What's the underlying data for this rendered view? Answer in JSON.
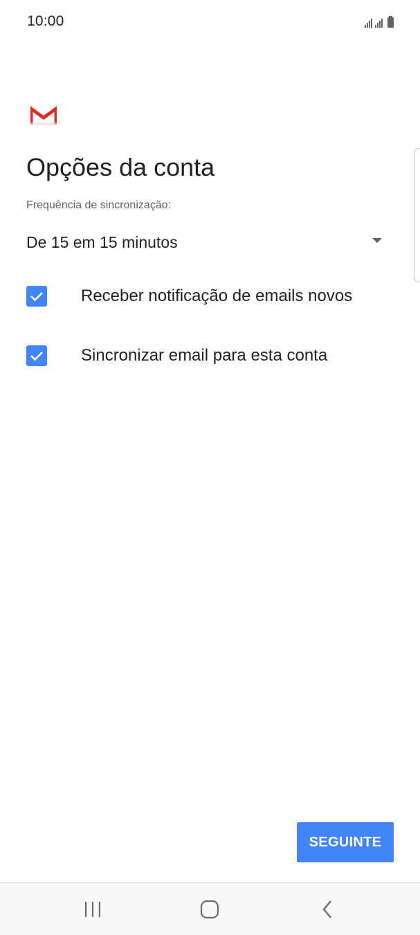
{
  "status_bar": {
    "time": "10:00",
    "icons": [
      "signal-icon",
      "signal-icon",
      "battery-icon"
    ]
  },
  "app": {
    "logo": "gmail-logo-icon",
    "accent_color": "#4285f4"
  },
  "page": {
    "title": "Opções da conta"
  },
  "sync": {
    "label": "Frequência de sincronização:",
    "value": "De 15 em 15 minutos"
  },
  "options": [
    {
      "label": "Receber notificação de emails novos",
      "checked": true
    },
    {
      "label": "Sincronizar email para esta conta",
      "checked": true
    }
  ],
  "actions": {
    "next_label": "SEGUINTE"
  },
  "nav_bar": {
    "buttons": [
      "recent-apps-icon",
      "home-icon",
      "back-icon"
    ]
  }
}
